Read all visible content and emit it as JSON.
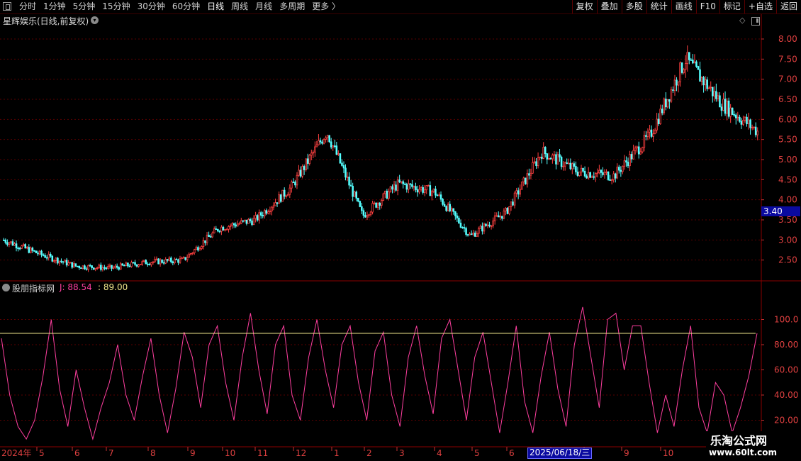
{
  "toolbar": {
    "periods": [
      "分时",
      "1分钟",
      "5分钟",
      "15分钟",
      "30分钟",
      "60分钟",
      "日线",
      "周线",
      "月线",
      "多周期",
      "更多 〉"
    ],
    "active_period": "日线",
    "buttons": [
      "复权",
      "叠加",
      "多股",
      "统计",
      "画线",
      "F10",
      "标记",
      "+自选",
      "返回"
    ]
  },
  "header": {
    "stock_title": "星辉娱乐(日线,前复权)"
  },
  "price_axis": {
    "labels": [
      "8.00",
      "7.50",
      "7.00",
      "6.50",
      "6.00",
      "5.50",
      "5.00",
      "4.50",
      "4.00",
      "3.50",
      "3.00",
      "2.50"
    ],
    "current_price_tag": "3.40"
  },
  "indicator": {
    "name": "股朋指标网",
    "j_label": "J: 88.54",
    "line_label": ": 89.00",
    "threshold": 89.0,
    "axis_labels": [
      "100.0",
      "80.00",
      "60.00",
      "40.00",
      "20.00"
    ]
  },
  "date_axis": {
    "labels": [
      "2024年",
      "5",
      "6",
      "7",
      "8",
      "9",
      "10",
      "11",
      "12",
      "1",
      "2",
      "3",
      "4",
      "5",
      "6",
      "7",
      "8",
      "9",
      "10"
    ],
    "cursor_date": "2025/06/18/三"
  },
  "watermark": {
    "title": "乐淘公式网",
    "url": "www.60lt.com"
  },
  "colors": {
    "up": "#ff4040",
    "down": "#54ffff",
    "j_line": "#ff3fa0",
    "threshold_line": "#f0e68c",
    "grid": "#5a0000"
  },
  "chart_data": [
    {
      "type": "candlestick",
      "title": "星辉娱乐(日线,前复权)",
      "ylim": [
        2.0,
        8.3
      ],
      "key_points": [
        {
          "x": "2024-04",
          "y": 3.0
        },
        {
          "x": "2024-05",
          "y": 2.65
        },
        {
          "x": "2024-06",
          "y": 2.35
        },
        {
          "x": "2024-07",
          "y": 2.3
        },
        {
          "x": "2024-08",
          "y": 2.45
        },
        {
          "x": "2024-09",
          "y": 2.5
        },
        {
          "x": "2024-10",
          "y": 3.3
        },
        {
          "x": "2024-11",
          "y": 3.5
        },
        {
          "x": "2024-12",
          "y": 4.3
        },
        {
          "x": "2024-12-late",
          "y": 5.7
        },
        {
          "x": "2025-01",
          "y": 3.6
        },
        {
          "x": "2025-02",
          "y": 4.4
        },
        {
          "x": "2025-03",
          "y": 4.2
        },
        {
          "x": "2025-04",
          "y": 3.1
        },
        {
          "x": "2025-05",
          "y": 3.7
        },
        {
          "x": "2025-06",
          "y": 5.2
        },
        {
          "x": "2025-07",
          "y": 4.7
        },
        {
          "x": "2025-08",
          "y": 4.6
        },
        {
          "x": "2025-09",
          "y": 5.6
        },
        {
          "x": "2025-09-late",
          "y": 7.5
        },
        {
          "x": "2025-10",
          "y": 6.4
        },
        {
          "x": "2025-11",
          "y": 5.7
        }
      ]
    },
    {
      "type": "line",
      "title": "股朋指标网",
      "ylim": [
        0,
        120
      ],
      "series": [
        {
          "name": "J",
          "values": [
            85,
            40,
            15,
            5,
            20,
            55,
            100,
            45,
            15,
            60,
            30,
            5,
            30,
            50,
            80,
            40,
            20,
            55,
            85,
            40,
            10,
            45,
            90,
            70,
            30,
            80,
            95,
            50,
            20,
            70,
            105,
            60,
            25,
            80,
            95,
            40,
            20,
            70,
            100,
            60,
            30,
            80,
            95,
            50,
            20,
            75,
            90,
            40,
            15,
            70,
            95,
            55,
            25,
            85,
            100,
            60,
            20,
            70,
            90,
            50,
            10,
            50,
            95,
            35,
            10,
            55,
            90,
            45,
            15,
            80,
            110,
            70,
            30,
            100,
            105,
            60,
            95,
            95,
            50,
            10,
            40,
            15,
            60,
            95,
            30,
            10,
            50,
            40,
            10,
            30,
            55,
            89
          ]
        },
        {
          "name": "threshold",
          "values": [
            89,
            89
          ]
        }
      ]
    }
  ]
}
